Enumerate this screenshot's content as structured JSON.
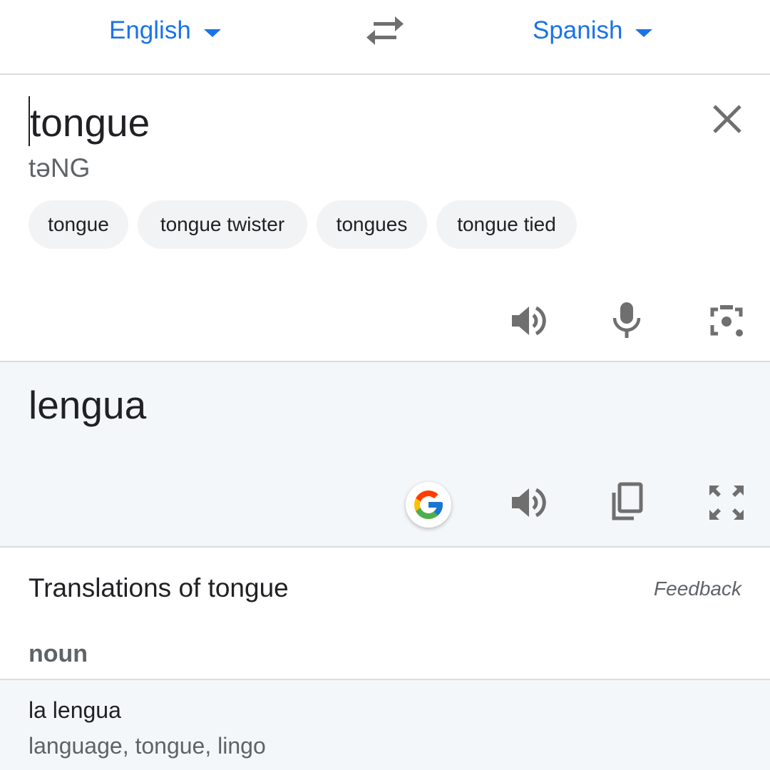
{
  "language_bar": {
    "source_language": "English",
    "target_language": "Spanish",
    "swap_icon": "swap-arrows-icon"
  },
  "source": {
    "text": "tongue",
    "phonetic": "təNG",
    "suggestions": [
      "tongue",
      "tongue twister",
      "tongues",
      "tongue tied"
    ],
    "icons": [
      "close-icon",
      "speaker-icon",
      "microphone-icon",
      "camera-lens-icon"
    ]
  },
  "result": {
    "text": "lengua",
    "icons": [
      "google-logo-icon",
      "speaker-icon",
      "copy-icon",
      "fullscreen-icon"
    ]
  },
  "translations": {
    "heading": "Translations of tongue",
    "feedback_label": "Feedback",
    "part_of_speech": "noun",
    "entries": [
      {
        "term": "la lengua",
        "back_translations": "language, tongue, lingo"
      }
    ]
  },
  "colors": {
    "accent": "#1a73e8",
    "icon_gray": "#6f6f6f",
    "result_bg": "#f4f7f9",
    "chip_bg": "#f1f3f4",
    "divider": "#dadce0"
  }
}
